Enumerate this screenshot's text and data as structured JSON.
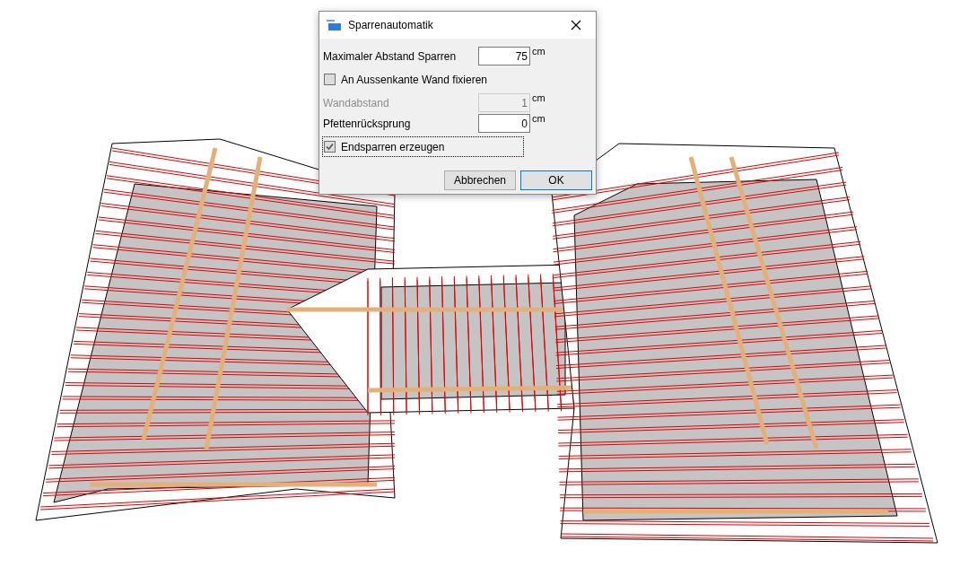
{
  "dialog": {
    "title": "Sparrenautomatik",
    "fields": [
      {
        "kind": "number",
        "label": "Maximaler Abstand Sparren",
        "value": "75",
        "unit": "cm",
        "disabled": false
      },
      {
        "kind": "checkbox",
        "label": "An Aussenkante Wand fixieren",
        "checked": false,
        "focused": false
      },
      {
        "kind": "number",
        "label": "Wandabstand",
        "value": "1",
        "unit": "cm",
        "disabled": true
      },
      {
        "kind": "number",
        "label": "Pfettenrücksprung",
        "value": "0",
        "unit": "cm",
        "disabled": false
      },
      {
        "kind": "checkbox",
        "label": "Endsparren erzeugen",
        "checked": true,
        "focused": true
      }
    ],
    "buttons": [
      {
        "label": "Abbrechen",
        "default": false
      },
      {
        "label": "OK",
        "default": true
      }
    ]
  }
}
